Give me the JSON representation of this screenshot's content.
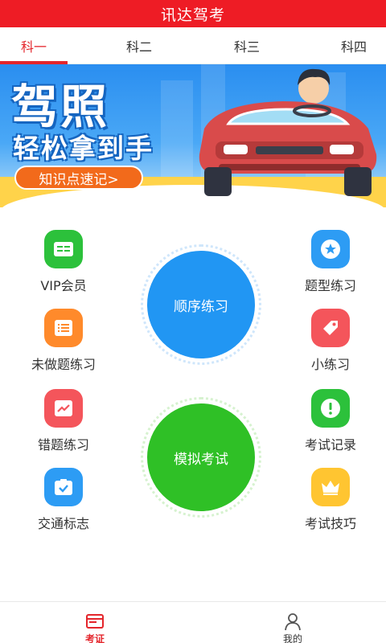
{
  "app": {
    "title": "讯达驾考"
  },
  "tabs": [
    {
      "label": "科一",
      "active": true
    },
    {
      "label": "科二",
      "active": false
    },
    {
      "label": "科三",
      "active": false
    },
    {
      "label": "科四",
      "active": false
    }
  ],
  "banner": {
    "title": "驾照",
    "subtitle": "轻松拿到手",
    "button": "知识点速记>"
  },
  "features_left": [
    {
      "label": "VIP会员",
      "icon": "card-icon",
      "color": "#2cc13b"
    },
    {
      "label": "未做题练习",
      "icon": "list-icon",
      "color": "#ff8a2b"
    },
    {
      "label": "错题练习",
      "icon": "trend-icon",
      "color": "#f4555b"
    },
    {
      "label": "交通标志",
      "icon": "check-badge-icon",
      "color": "#2d9cf4"
    }
  ],
  "features_right": [
    {
      "label": "题型练习",
      "icon": "star-icon",
      "color": "#2d9cf4"
    },
    {
      "label": "小练习",
      "icon": "tag-icon",
      "color": "#f4555b"
    },
    {
      "label": "考试记录",
      "icon": "alert-icon",
      "color": "#2cc13b"
    },
    {
      "label": "考试技巧",
      "icon": "crown-icon",
      "color": "#ffc531"
    }
  ],
  "center_buttons": {
    "sequential": {
      "label": "顺序练习",
      "color": "#2196f3"
    },
    "mock_exam": {
      "label": "模拟考试",
      "color": "#2fc026"
    }
  },
  "bottom_nav": [
    {
      "label": "考证",
      "icon": "license-icon",
      "active": true
    },
    {
      "label": "我的",
      "icon": "person-icon",
      "active": false
    }
  ],
  "colors": {
    "brand": "#ee1c25",
    "accent_text": "#e4262c"
  }
}
